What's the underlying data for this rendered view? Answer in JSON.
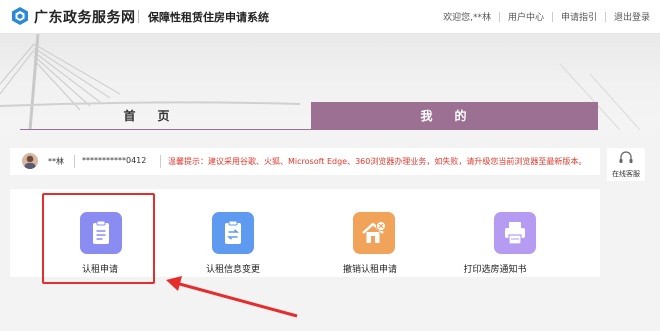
{
  "header": {
    "site_name": "广东政务服务网",
    "system_name": "保障性租赁住房申请系统",
    "greeting": "欢迎您,**林",
    "links": [
      "用户中心",
      "申请指引",
      "退出登录"
    ]
  },
  "tabs": [
    {
      "label": "首页",
      "active": false
    },
    {
      "label": "我的",
      "active": true
    }
  ],
  "user": {
    "name": "**林",
    "id_masked": "***********0412"
  },
  "notice": "温馨提示：建议采用谷歌、火狐、Microsoft Edge、360浏览器办理业务，如失败，请升级您当前浏览器至最新版本。",
  "online_service": "在线客服",
  "functions": [
    {
      "label": "认租申请",
      "icon": "clipboard-icon",
      "color": "#8a8cf2",
      "highlighted": true
    },
    {
      "label": "认租信息变更",
      "icon": "transfer-doc-icon",
      "color": "#5e9bf0"
    },
    {
      "label": "撤销认租申请",
      "icon": "house-cancel-icon",
      "color": "#f1a35a"
    },
    {
      "label": "打印选房通知书",
      "icon": "printer-icon",
      "color": "#b59bf2"
    }
  ],
  "colors": {
    "tab_active": "#9b7093",
    "notice_text": "#e0382c",
    "highlight": "#e52d2d"
  }
}
